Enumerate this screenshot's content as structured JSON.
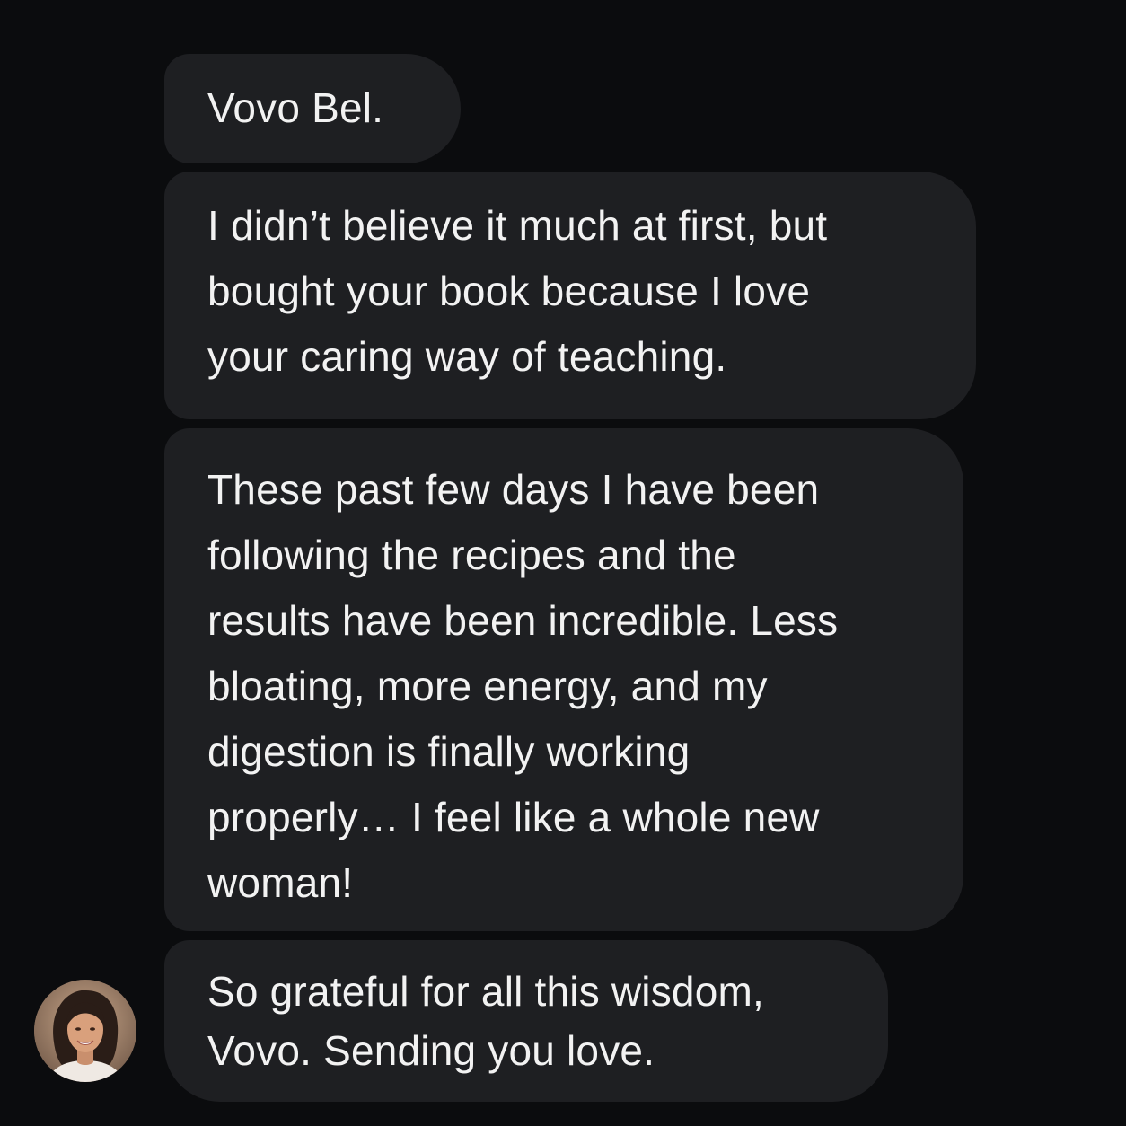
{
  "conversation": {
    "messages": [
      {
        "lines": [
          "Vovo Bel."
        ]
      },
      {
        "lines": [
          "I didn’t believe it much at first, but",
          "bought your book because I love",
          "your caring way of teaching."
        ]
      },
      {
        "lines": [
          "These past few days I have been",
          "following the recipes and the",
          "results have been incredible. Less",
          "bloating, more energy, and my",
          "digestion is finally working",
          "properly… I feel like a whole new",
          "woman!"
        ]
      },
      {
        "lines": [
          "So grateful for all this wisdom,",
          "Vovo. Sending you love."
        ]
      }
    ],
    "sender_avatar": "woman-portrait-avatar"
  },
  "colors": {
    "background": "#0b0c0e",
    "bubble": "#1e1f22",
    "text": "#f2f2f2"
  }
}
